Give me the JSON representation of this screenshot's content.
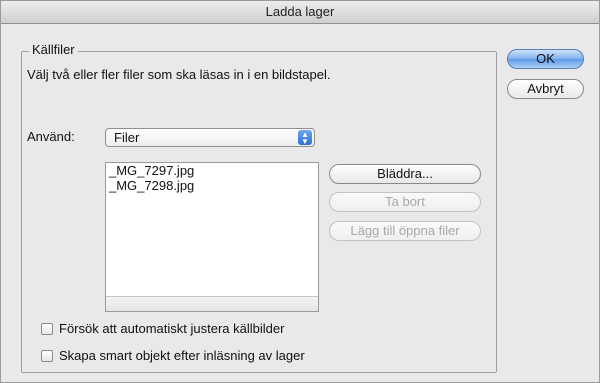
{
  "window": {
    "title": "Ladda lager"
  },
  "source_group": {
    "legend": "Källfiler",
    "description": "Välj två eller fler filer som ska läsas in i en bildstapel.",
    "use_label": "Använd:",
    "use_selected": "Filer",
    "files": [
      "_MG_7297.jpg",
      "_MG_7298.jpg"
    ],
    "browse_label": "Bläddra...",
    "remove_label": "Ta bort",
    "add_open_label": "Lägg till öppna filer"
  },
  "options": {
    "auto_align_label": "Försök att automatiskt justera källbilder",
    "smart_object_label": "Skapa smart objekt efter inläsning av lager"
  },
  "buttons": {
    "ok_label": "OK",
    "cancel_label": "Avbryt"
  }
}
